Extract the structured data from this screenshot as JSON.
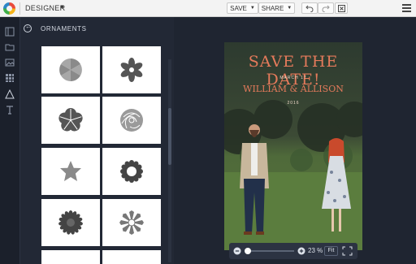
{
  "topbar": {
    "designer_label": "DESIGNER",
    "save_label": "SAVE",
    "share_label": "SHARE"
  },
  "panel": {
    "title": "ORNAMENTS"
  },
  "card": {
    "headline": "SAVE THE DATE!",
    "date_line": "MARCH 17",
    "names": "WILLIAM & ALLISON",
    "year": "2016"
  },
  "zoom": {
    "percent": "23 %",
    "fit_label": "Fit",
    "slider_level": 0.05
  },
  "colors": {
    "accent_title": "#e57a5b",
    "panel_bg": "#222835",
    "stage_bg": "#1f2531",
    "ornament": "#6b6b6b"
  },
  "icons": [
    "logo-icon",
    "undo-icon",
    "redo-icon",
    "close-icon",
    "menu-icon",
    "back-icon",
    "folder-icon",
    "image-icon",
    "grid-icon",
    "shape-icon",
    "text-icon"
  ],
  "ornaments": [
    "pinwheel-flower",
    "six-petal-flower",
    "five-petal-flower",
    "rose",
    "star",
    "cog-flower",
    "daisy",
    "sunburst-flower"
  ]
}
